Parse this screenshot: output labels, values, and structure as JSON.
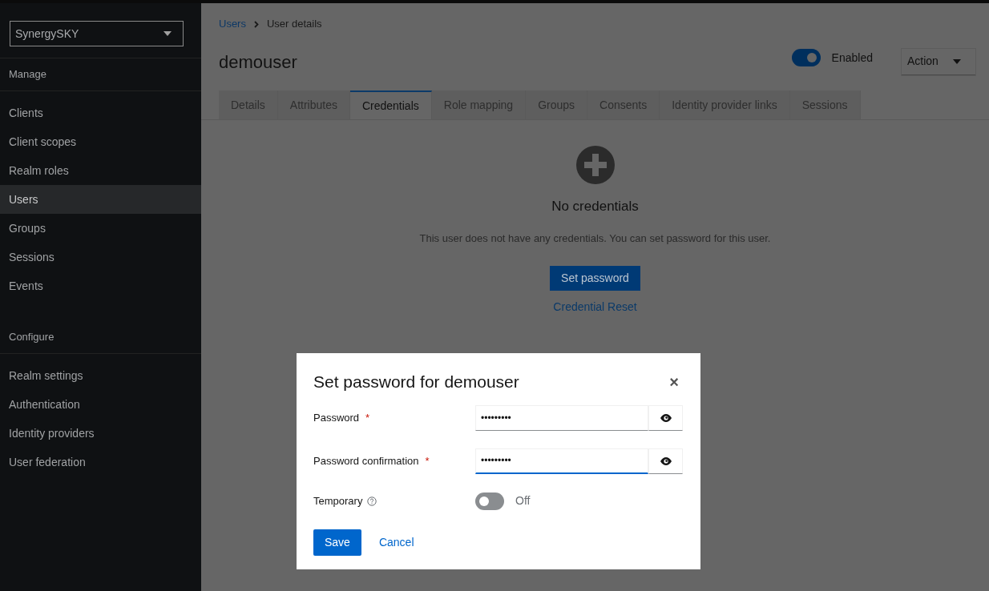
{
  "sidebar": {
    "realm_selector": "SynergySKY",
    "sections": [
      {
        "title": "Manage",
        "items": [
          {
            "label": "Clients",
            "selected": false
          },
          {
            "label": "Client scopes",
            "selected": false
          },
          {
            "label": "Realm roles",
            "selected": false
          },
          {
            "label": "Users",
            "selected": true
          },
          {
            "label": "Groups",
            "selected": false
          },
          {
            "label": "Sessions",
            "selected": false
          },
          {
            "label": "Events",
            "selected": false
          }
        ]
      },
      {
        "title": "Configure",
        "items": [
          {
            "label": "Realm settings",
            "selected": false
          },
          {
            "label": "Authentication",
            "selected": false
          },
          {
            "label": "Identity providers",
            "selected": false
          },
          {
            "label": "User federation",
            "selected": false
          }
        ]
      }
    ]
  },
  "breadcrumb": [
    {
      "label": "Users",
      "link": true
    },
    {
      "label": "User details",
      "link": false
    }
  ],
  "page_title": "demouser",
  "enabled_switch": {
    "label": "Enabled",
    "on": true
  },
  "action_button": "Action",
  "tabs": [
    {
      "label": "Details",
      "selected": false
    },
    {
      "label": "Attributes",
      "selected": false
    },
    {
      "label": "Credentials",
      "selected": true
    },
    {
      "label": "Role mapping",
      "selected": false
    },
    {
      "label": "Groups",
      "selected": false
    },
    {
      "label": "Consents",
      "selected": false
    },
    {
      "label": "Identity provider links",
      "selected": false
    },
    {
      "label": "Sessions",
      "selected": false
    }
  ],
  "empty_state": {
    "title": "No credentials",
    "message": "This user does not have any credentials. You can set password for this user.",
    "primary_button": "Set password",
    "link": "Credential Reset"
  },
  "modal": {
    "title": "Set password for demouser",
    "close": "×",
    "fields": [
      {
        "label": "Password",
        "required_mark": "*",
        "value": "•••••••••",
        "focused": false
      },
      {
        "label": "Password confirmation",
        "required_mark": "*",
        "value": "•••••••••",
        "focused": true
      }
    ],
    "temporary": {
      "label": "Temporary",
      "on": false,
      "state_text": "Off"
    },
    "buttons": [
      {
        "label": "Save",
        "kind": "primary"
      },
      {
        "label": "Cancel",
        "kind": "link"
      }
    ]
  }
}
